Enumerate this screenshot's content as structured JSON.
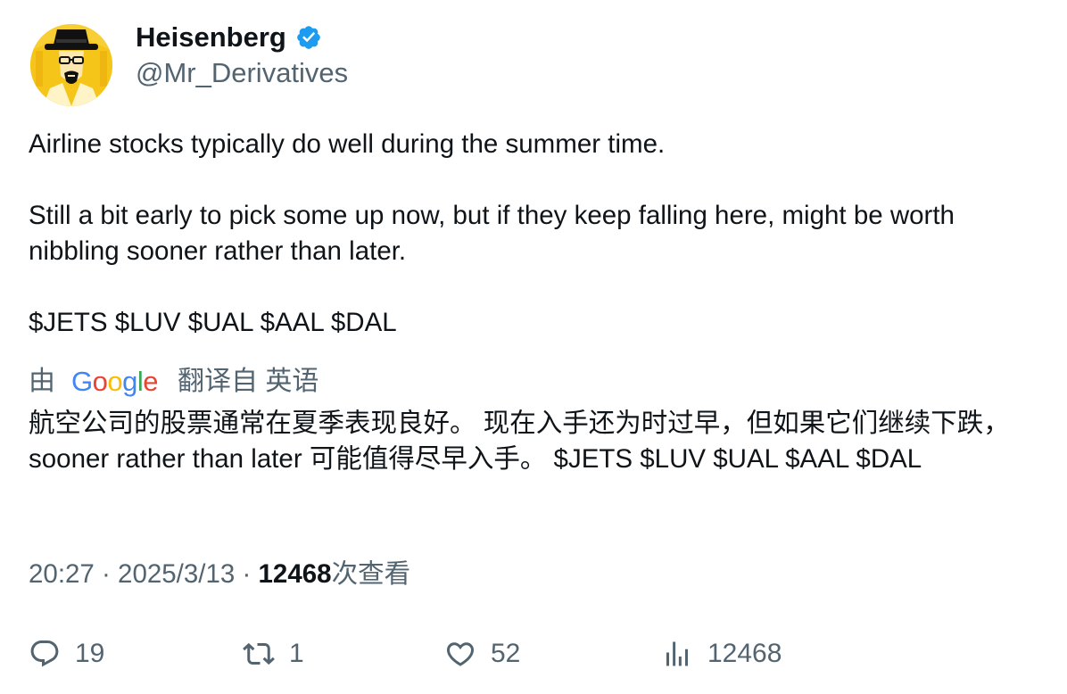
{
  "author": {
    "display_name": "Heisenberg",
    "handle": "@Mr_Derivatives",
    "verified": true,
    "avatar_icon": "heisenberg-avatar-icon"
  },
  "tweet": {
    "text": "Airline stocks typically do well during the summer time.\n\nStill a bit early to pick some up now, but if they keep falling here, might be worth nibbling sooner rather than later.\n\n$JETS $LUV $UAL $AAL $DAL"
  },
  "translation": {
    "prefix": "由",
    "provider": "Google",
    "label": "翻译自 英语",
    "text": "航空公司的股票通常在夏季表现良好。 现在入手还为时过早，但如果它们继续下跌， sooner rather than later 可能值得尽早入手。 $JETS $LUV $UAL $AAL $DAL"
  },
  "meta": {
    "time": "20:27",
    "separator": " · ",
    "date": "2025/3/13",
    "views_count": "12468",
    "views_label": "次查看"
  },
  "actions": {
    "replies": "19",
    "retweets": "1",
    "likes": "52",
    "views": "12468"
  },
  "colors": {
    "text_primary": "#0f1419",
    "text_secondary": "#536471",
    "verified_blue": "#1d9bf0",
    "avatar_yellow": "#f6c519"
  }
}
